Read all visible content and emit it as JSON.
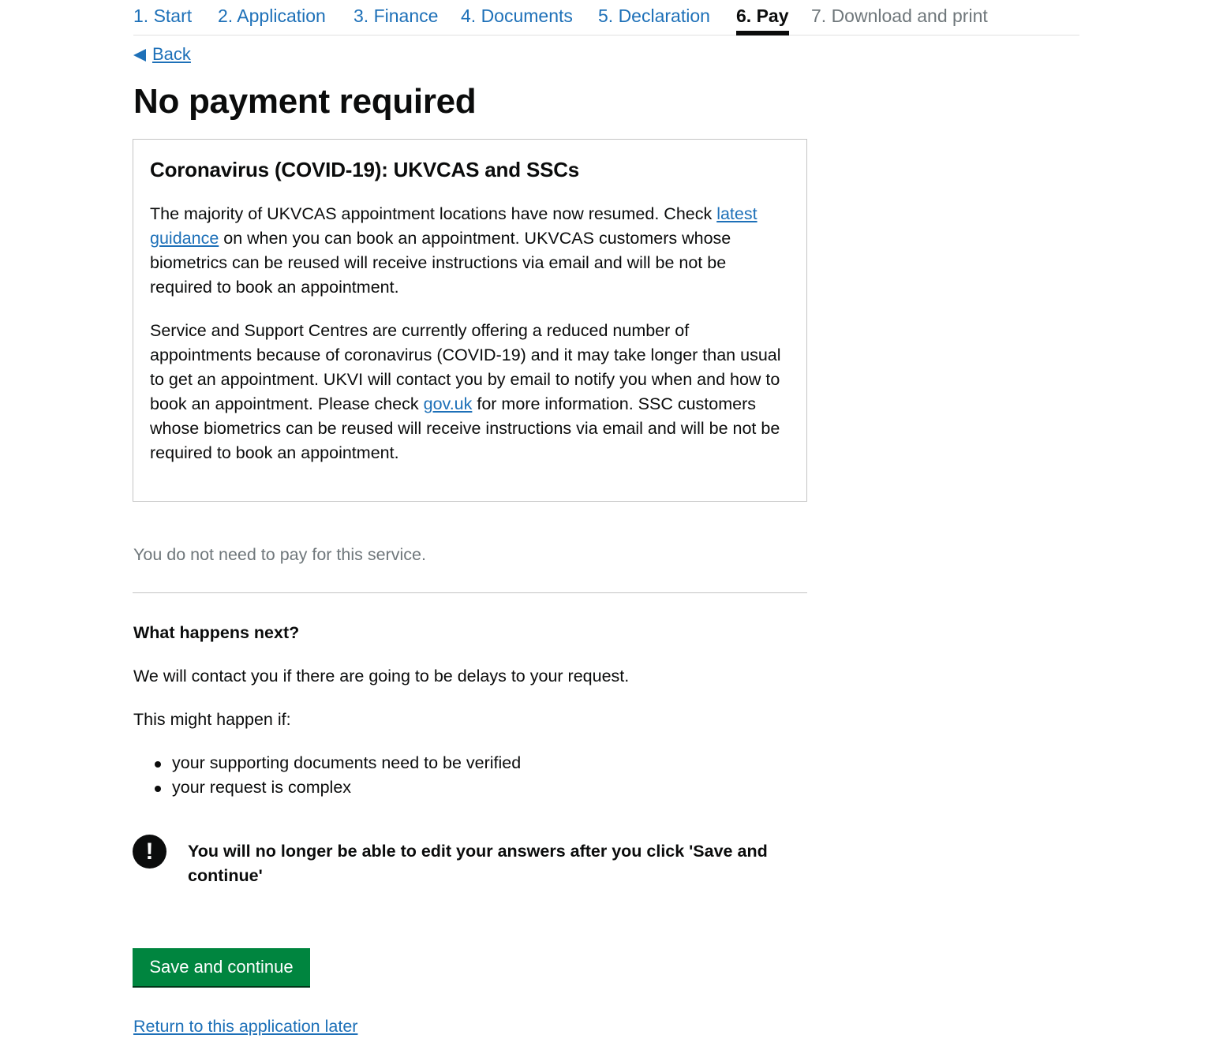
{
  "steps": [
    {
      "label": "1. Start",
      "state": "link"
    },
    {
      "label": "2. Application",
      "state": "link"
    },
    {
      "label": "3. Finance",
      "state": "link"
    },
    {
      "label": "4. Documents",
      "state": "link"
    },
    {
      "label": "5. Declaration",
      "state": "link"
    },
    {
      "label": "6. Pay",
      "state": "current"
    },
    {
      "label": "7. Download and print",
      "state": "disabled"
    }
  ],
  "back": {
    "label": "Back"
  },
  "page_title": "No payment required",
  "notice": {
    "title": "Coronavirus (COVID-19): UKVCAS and SSCs",
    "p1_before": "The majority of UKVCAS appointment locations have now resumed. Check ",
    "p1_link": "latest guidance",
    "p1_after": " on when you can book an appointment. UKVCAS customers whose biometrics can be reused will receive instructions via email and will be not be required to book an appointment.",
    "p2_before": "Service and Support Centres are currently offering a reduced number of appointments because of coronavirus (COVID-19) and it may take longer than usual to get an appointment. UKVI will contact you by email to notify you when and how to book an appointment. Please check ",
    "p2_link": "gov.uk",
    "p2_after": " for more information. SSC customers whose biometrics can be reused will receive instructions via email and will be not be required to book an appointment."
  },
  "no_pay_text": "You do not need to pay for this service.",
  "next": {
    "heading": "What happens next?",
    "contact_text": "We will contact you if there are going to be delays to your request.",
    "might_text": "This might happen if:",
    "bullets": [
      "your supporting documents need to be verified",
      "your request is complex"
    ]
  },
  "warning": {
    "icon": "!",
    "text": "You will no longer be able to edit your answers after you click 'Save and continue'"
  },
  "actions": {
    "save_label": "Save and continue",
    "later_label": "Return to this application later"
  },
  "colors": {
    "link": "#1d70b8",
    "text": "#0b0c0c",
    "muted": "#6f777b",
    "button": "#00853f"
  }
}
